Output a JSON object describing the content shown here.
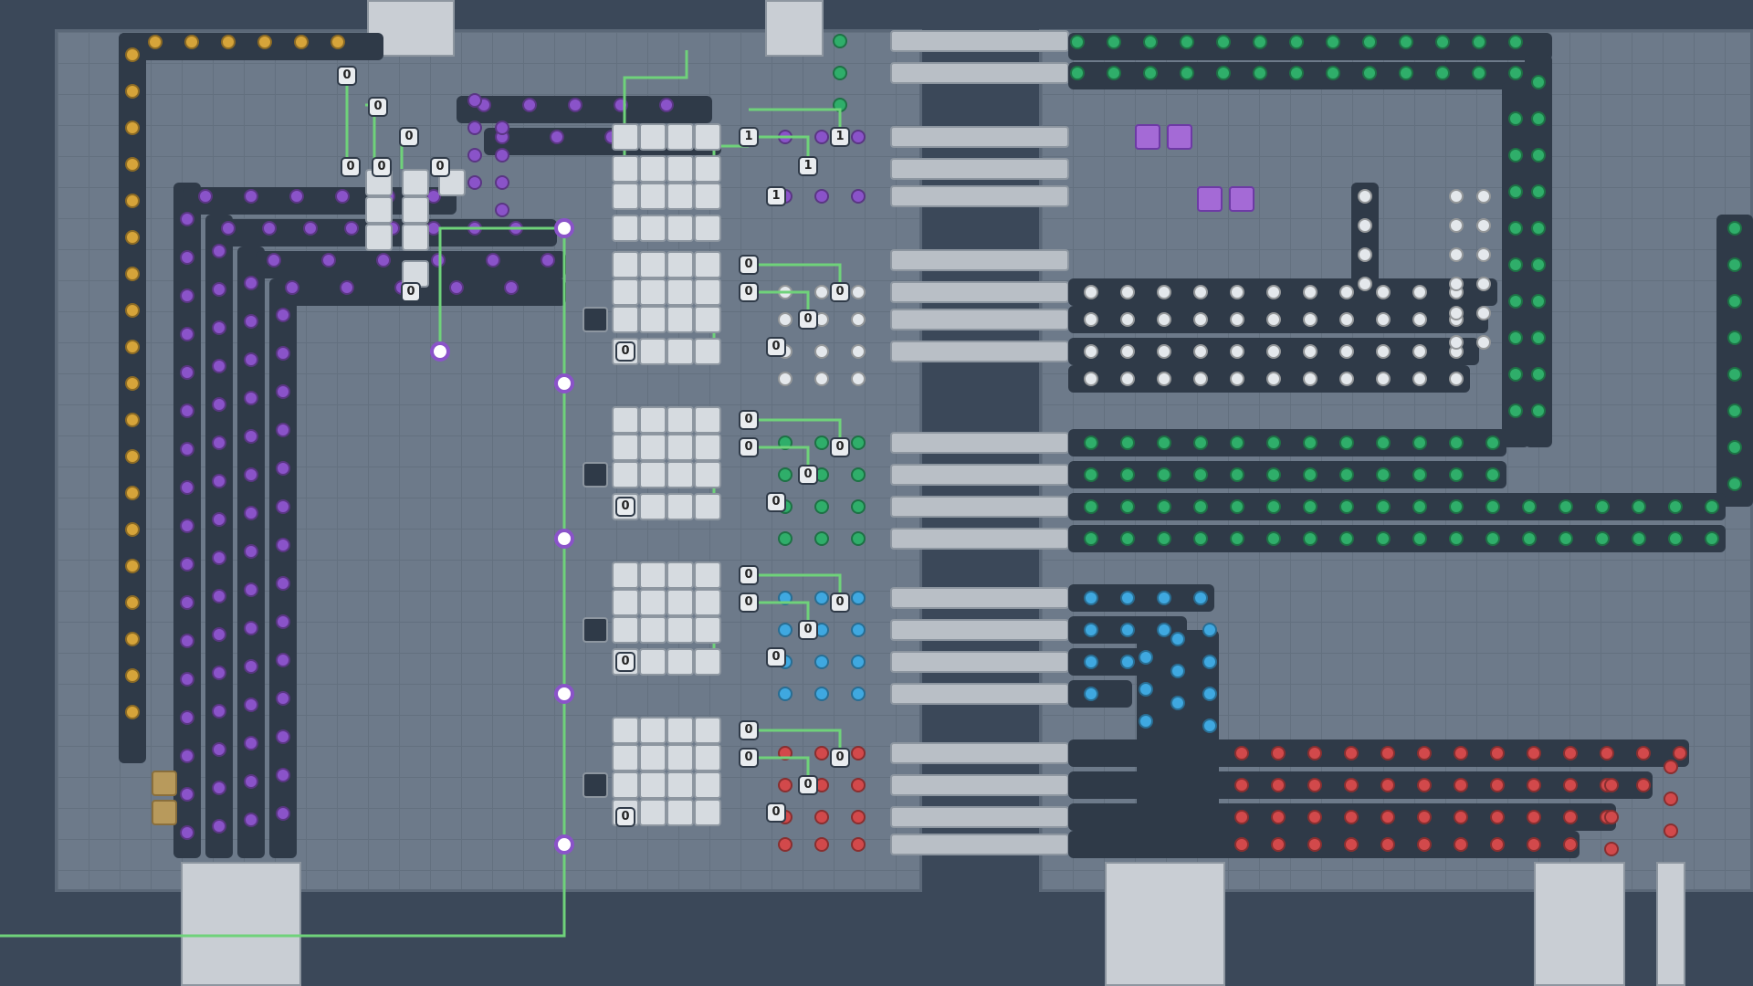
{
  "colors": {
    "background": "#3b4859",
    "platform": "#6d7a8a",
    "belt": "#2f3a48",
    "wire": "#6fd27a",
    "shape_gold": "#d6a43a",
    "shape_purple": "#8a53c9",
    "shape_green": "#2fae6a",
    "shape_white": "#e4e8ec",
    "shape_blue": "#3fa8e0",
    "shape_red": "#d2494b"
  },
  "icons": {
    "gold_item": "lightning-shape-icon",
    "purple_item": "hexagon-shape-icon",
    "green_item": "gear-shape-icon",
    "white_item": "snowflake-shape-icon",
    "blue_item": "droplet-shape-icon",
    "red_item": "gem-shape-icon",
    "tunnel": "space-belt-tunnel-icon",
    "antenna": "signal-antenna-icon",
    "gate": "logic-gate-icon"
  },
  "signals": {
    "top": [
      "0",
      "0",
      "0",
      "0",
      "0",
      "0",
      "0"
    ],
    "top_stack": [
      "1",
      "1",
      "1",
      "1"
    ],
    "block_white": [
      "0",
      "0",
      "0",
      "0",
      "0",
      "0"
    ],
    "block_green": [
      "0",
      "0",
      "0",
      "0",
      "0",
      "0"
    ],
    "block_blue": [
      "0",
      "0",
      "0",
      "0",
      "0",
      "0"
    ],
    "block_red": [
      "0",
      "0",
      "0",
      "0",
      "0",
      "0"
    ]
  }
}
